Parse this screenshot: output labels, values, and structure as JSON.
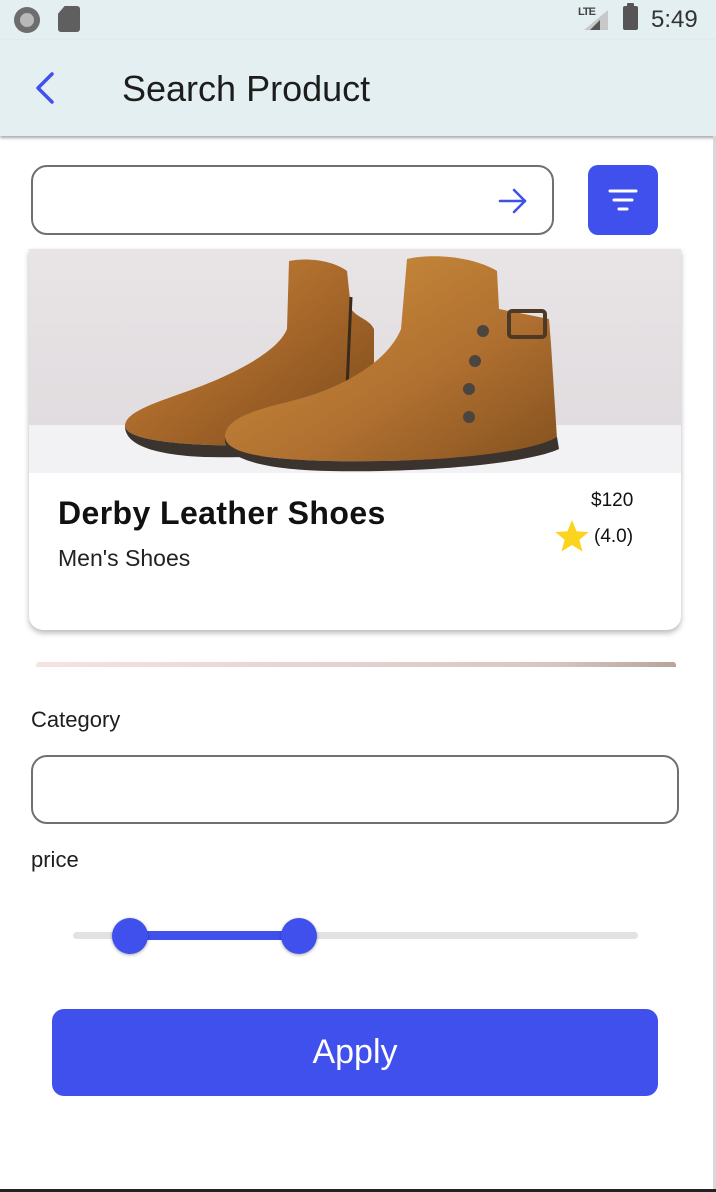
{
  "status_bar": {
    "network": "LTE",
    "time": "5:49",
    "icons": [
      "record-icon",
      "sd-card-icon",
      "signal-icon",
      "battery-icon"
    ]
  },
  "app_bar": {
    "title": "Search Product",
    "back_icon": "back-arrow-icon"
  },
  "search": {
    "value": "",
    "placeholder": "",
    "submit_icon": "arrow-right-icon",
    "filter_icon": "filter-icon"
  },
  "product_card": {
    "name": "Derby Leather Shoes",
    "category": "Men's Shoes",
    "price": "$120",
    "rating": "(4.0)",
    "rating_icon": "star-icon"
  },
  "filters": {
    "category_label": "Category",
    "category_value": "",
    "price_label": "price",
    "price_range": {
      "low_fraction": 0.1,
      "high_fraction": 0.4
    },
    "apply_label": "Apply"
  },
  "colors": {
    "accent": "#4050ec",
    "app_bar_bg": "#e4eff1",
    "star": "#fbd41f"
  }
}
